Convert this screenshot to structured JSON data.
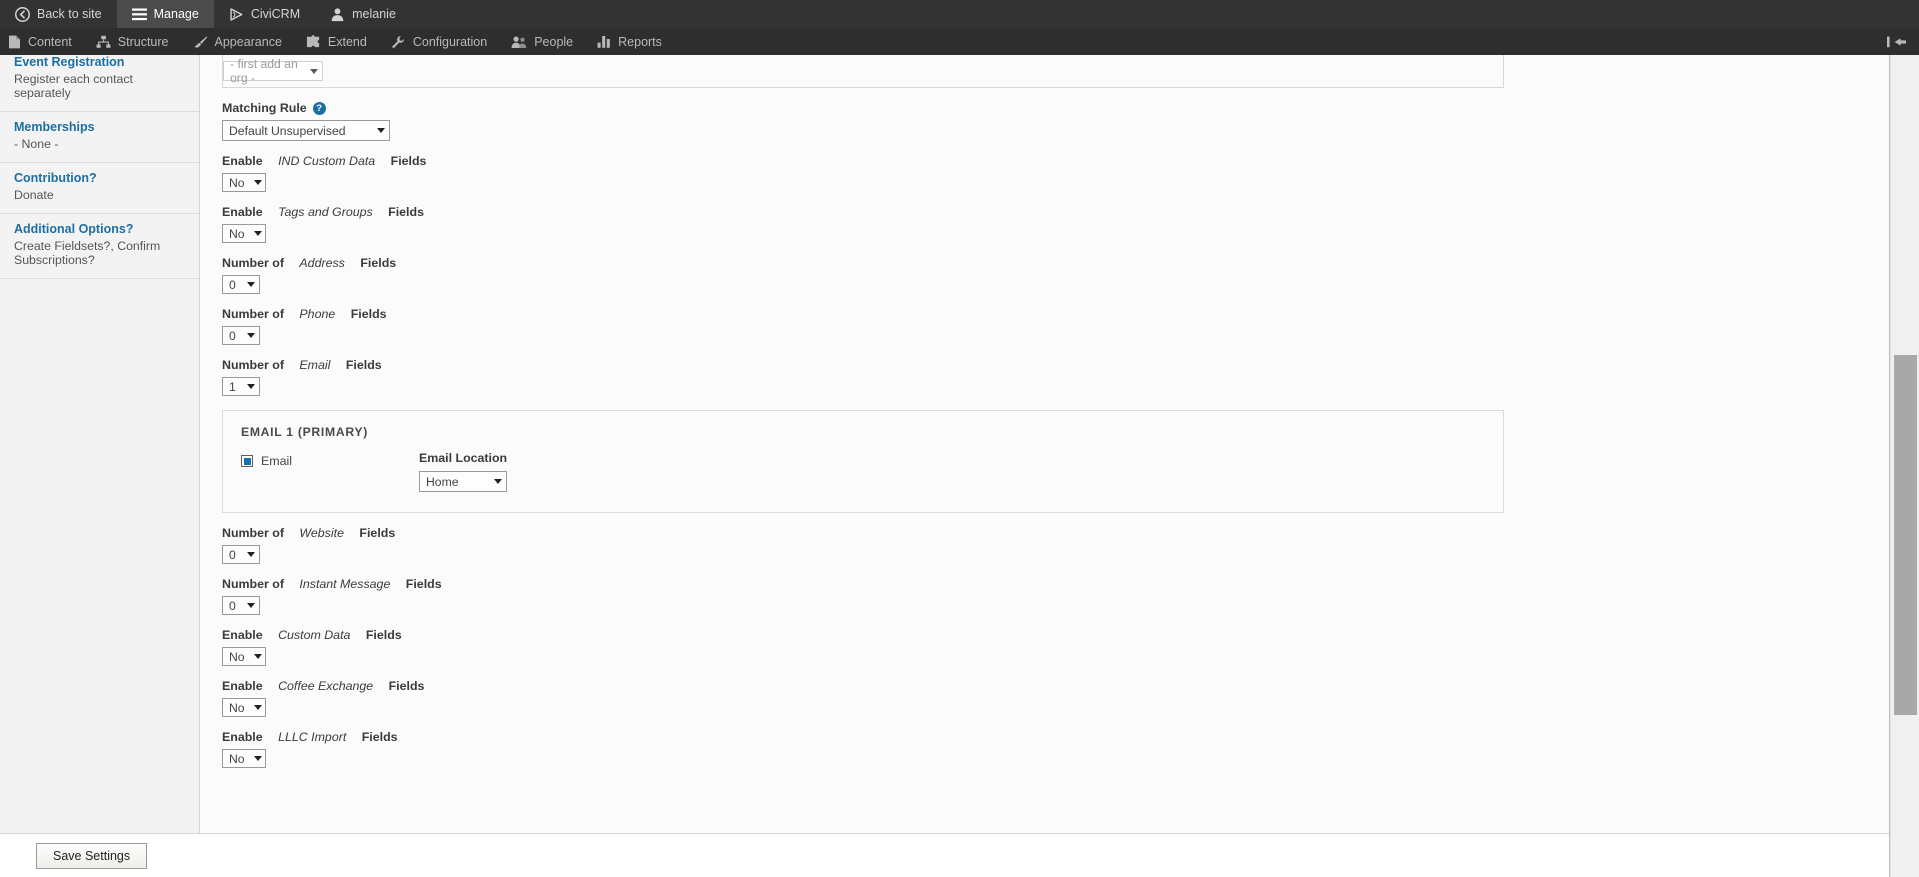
{
  "toolbar": {
    "primary": [
      {
        "label": "Back to site",
        "icon": "back-arrow-icon",
        "active": false
      },
      {
        "label": "Manage",
        "icon": "hamburger-icon",
        "active": true
      },
      {
        "label": "CiviCRM",
        "icon": "civicrm-icon",
        "active": false
      },
      {
        "label": "melanie",
        "icon": "user-icon",
        "active": false
      }
    ],
    "secondary": [
      {
        "label": "Content",
        "icon": "document-icon"
      },
      {
        "label": "Structure",
        "icon": "structure-icon"
      },
      {
        "label": "Appearance",
        "icon": "paintbrush-icon"
      },
      {
        "label": "Extend",
        "icon": "puzzle-icon"
      },
      {
        "label": "Configuration",
        "icon": "wrench-icon"
      },
      {
        "label": "People",
        "icon": "people-icon"
      },
      {
        "label": "Reports",
        "icon": "bar-chart-icon"
      }
    ],
    "toggle_icon": "collapse-toolbar-icon"
  },
  "sidebar": {
    "items": [
      {
        "title": "Event Registration",
        "subtitle": "Register each contact separately"
      },
      {
        "title": "Memberships",
        "subtitle": "- None -"
      },
      {
        "title": "Contribution?",
        "subtitle": "Donate"
      },
      {
        "title": "Additional Options?",
        "subtitle": "Create Fieldsets?, Confirm Subscriptions?"
      }
    ]
  },
  "main": {
    "org_select": {
      "value": "- first add an org -"
    },
    "matching_rule": {
      "label": "Matching Rule",
      "value": "Default Unsupervised",
      "help_icon": "help-icon",
      "help_glyph": "?"
    },
    "fields": [
      {
        "prefix": "Enable",
        "emphasis": "IND Custom Data",
        "suffix": "Fields",
        "value": "No",
        "size": "md"
      },
      {
        "prefix": "Enable",
        "emphasis": "Tags and Groups",
        "suffix": "Fields",
        "value": "No",
        "size": "md"
      },
      {
        "prefix": "Number of",
        "emphasis": "Address",
        "suffix": "Fields",
        "value": "0",
        "size": "sm"
      },
      {
        "prefix": "Number of",
        "emphasis": "Phone",
        "suffix": "Fields",
        "value": "0",
        "size": "sm"
      },
      {
        "prefix": "Number of",
        "emphasis": "Email",
        "suffix": "Fields",
        "value": "1",
        "size": "sm"
      }
    ],
    "email_fieldset": {
      "legend": "EMAIL 1 (PRIMARY)",
      "checkbox_label": "Email",
      "checkbox_checked": true,
      "location_label": "Email Location",
      "location_value": "Home"
    },
    "fields_after": [
      {
        "prefix": "Number of",
        "emphasis": "Website",
        "suffix": "Fields",
        "value": "0",
        "size": "sm"
      },
      {
        "prefix": "Number of",
        "emphasis": "Instant Message",
        "suffix": "Fields",
        "value": "0",
        "size": "sm"
      },
      {
        "prefix": "Enable",
        "emphasis": "Custom Data",
        "suffix": "Fields",
        "value": "No",
        "size": "md"
      },
      {
        "prefix": "Enable",
        "emphasis": "Coffee Exchange",
        "suffix": "Fields",
        "value": "No",
        "size": "md"
      },
      {
        "prefix": "Enable",
        "emphasis": "LLLC Import",
        "suffix": "Fields",
        "value": "No",
        "size": "md"
      }
    ]
  },
  "footer": {
    "save_label": "Save Settings"
  },
  "colors": {
    "toolbar_bg": "#333333",
    "toolbar_sub_bg": "#2e2e2e",
    "link_blue": "#1d6fa3",
    "accent_blue": "#1a6fad",
    "sidebar_bg": "#f3f3f3"
  }
}
